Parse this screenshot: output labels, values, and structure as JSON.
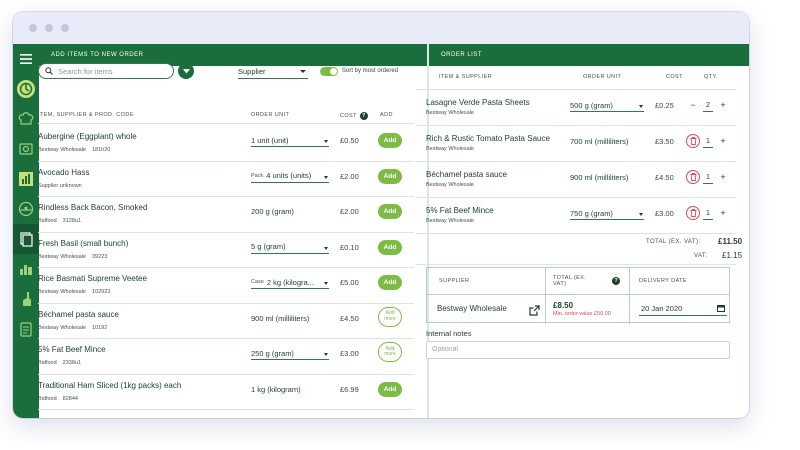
{
  "left_panel": {
    "header": "ADD ITEMS TO NEW ORDER",
    "search_placeholder": "Search for items",
    "supplier_filter": "Supplier",
    "sort_label": "Sort by most ordered",
    "sort_toggle_on": true,
    "columns": {
      "item": "ITEM, SUPPLIER & PROD. CODE",
      "unit": "ORDER UNIT",
      "cost": "COST",
      "add": "ADD"
    },
    "items": [
      {
        "name": "Aubergine (Eggplant) whole",
        "supplier": "Bestway Wholesale",
        "code": "181h20",
        "unit_prefix": "",
        "unit": "1 unit (unit)",
        "dropdown": true,
        "cost": "£0.50",
        "action": "Add"
      },
      {
        "name": "Avocado Hass",
        "supplier": "Supplier unknown",
        "code": "",
        "unit_prefix": "Pack",
        "unit": "4 units (units)",
        "dropdown": true,
        "cost": "£2.00",
        "action": "Add"
      },
      {
        "name": "Rindless Back Bacon, Smoked",
        "supplier": "Bidfood",
        "code": "3128u1",
        "unit_prefix": "",
        "unit": "200 g (gram)",
        "dropdown": false,
        "cost": "£2.00",
        "action": "Add"
      },
      {
        "name": "Fresh Basil (small bunch)",
        "supplier": "Bestway Wholesale",
        "code": "39223",
        "unit_prefix": "",
        "unit": "5 g (gram)",
        "dropdown": true,
        "cost": "£0.10",
        "action": "Add"
      },
      {
        "name": "Rice Basmati Supreme Veetee",
        "supplier": "Bestway Wholesale",
        "code": "102923",
        "unit_prefix": "Case",
        "unit": "2 kg (kilogra...",
        "dropdown": true,
        "cost": "£5.00",
        "action": "Add"
      },
      {
        "name": "Béchamel pasta sauce",
        "supplier": "Bestway Wholesale",
        "code": "10192",
        "unit_prefix": "",
        "unit": "900 ml (milliliters)",
        "dropdown": false,
        "cost": "£4.50",
        "action": "Add more"
      },
      {
        "name": "5% Fat Beef Mince",
        "supplier": "Bidfood",
        "code": "2338u1",
        "unit_prefix": "",
        "unit": "250 g (gram)",
        "dropdown": true,
        "cost": "£3.00",
        "action": "Add more"
      },
      {
        "name": "Traditional Ham Sliced (1kg packs) each",
        "supplier": "Bidfood",
        "code": "82844",
        "unit_prefix": "",
        "unit": "1 kg (kilogram)",
        "dropdown": false,
        "cost": "£6.99",
        "action": "Add"
      }
    ]
  },
  "right_panel": {
    "header": "ORDER LIST",
    "columns": {
      "item": "ITEM & SUPPLIER",
      "unit": "ORDER UNIT",
      "cost": "COST",
      "qty": "QTY."
    },
    "items": [
      {
        "name": "Lasagne Verde Pasta Sheets",
        "supplier": "Bestway Wholesale",
        "unit": "500 g (gram)",
        "dropdown": true,
        "cost": "£0.25",
        "qty": "2",
        "qty_control": "minus"
      },
      {
        "name": "Rich & Rustic Tomato Pasta Sauce",
        "supplier": "Bestway Wholesale",
        "unit": "700 ml (milliliters)",
        "dropdown": false,
        "cost": "£3.50",
        "qty": "1",
        "qty_control": "trash"
      },
      {
        "name": "Béchamel pasta sauce",
        "supplier": "Bestway Wholesale",
        "unit": "900 ml (milliliters)",
        "dropdown": false,
        "cost": "£4.50",
        "qty": "1",
        "qty_control": "trash"
      },
      {
        "name": "5% Fat Beef Mince",
        "supplier": "Bestway Wholesale",
        "unit": "750 g (gram)",
        "dropdown": true,
        "cost": "£3.00",
        "qty": "1",
        "qty_control": "trash"
      }
    ],
    "total_label": "TOTAL (EX. VAT):",
    "total_value": "£11.50",
    "vat_label": "VAT:",
    "vat_value": "£1.15",
    "supplier_table": {
      "col_supplier": "SUPPLIER",
      "col_total": "TOTAL (EX. VAT)",
      "col_delivery": "DELIVERY DATE",
      "supplier_name": "Bestway Wholesale",
      "total": "£8.50",
      "min_order": "Min. order value £50.00",
      "delivery_date": "20 Jan 2020"
    },
    "notes_label": "Internal notes",
    "notes_placeholder": "Optional"
  },
  "colors": {
    "brand": "#1a6e3c",
    "accent": "#7dbb45",
    "warning": "#d94a55"
  },
  "sidebar_icons": [
    "menu-icon",
    "logo-icon",
    "chef-hat-icon",
    "register-icon",
    "reports-icon",
    "dashboard-icon",
    "orders-icon",
    "inventory-icon",
    "cleaning-icon",
    "clipboard-icon"
  ]
}
